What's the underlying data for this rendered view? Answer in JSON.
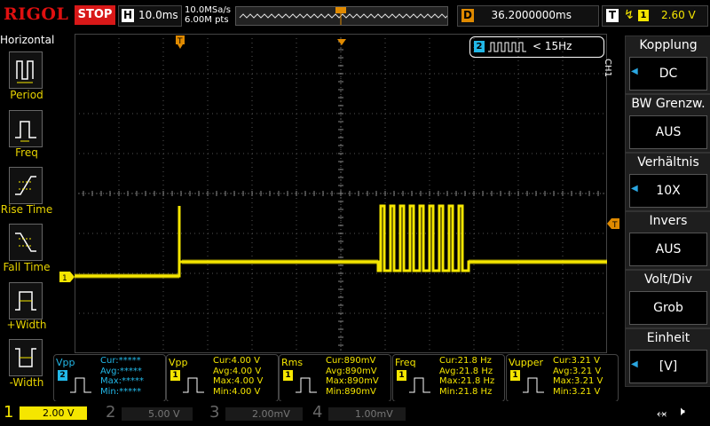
{
  "brand": "RIGOL",
  "run_state": "STOP",
  "horizontal": {
    "label": "H",
    "timebase": "10.0ms"
  },
  "sample": {
    "rate": "10.0MSa/s",
    "points": "6.00M pts"
  },
  "delay": {
    "label": "D",
    "value": "36.2000000ms"
  },
  "trigger": {
    "label": "T",
    "source": "1",
    "level": "2.60 V"
  },
  "left_menu": {
    "title": "Horizontal",
    "items": [
      {
        "label": "Period"
      },
      {
        "label": "Freq"
      },
      {
        "label": "Rise Time"
      },
      {
        "label": "Fall Time"
      },
      {
        "label": "+Width"
      },
      {
        "label": "-Width"
      }
    ]
  },
  "channel_tag": "CH1",
  "freq_counter": {
    "channel": "2",
    "value": "< 15Hz"
  },
  "right_menu": [
    {
      "title": "Kopplung",
      "value": "DC"
    },
    {
      "title": "BW Grenzw.",
      "value": "AUS"
    },
    {
      "title": "Verhältnis",
      "value": "10X"
    },
    {
      "title": "Invers",
      "value": "AUS"
    },
    {
      "title": "Volt/Div",
      "value": "Grob"
    },
    {
      "title": "Einheit",
      "value": "[V]"
    }
  ],
  "measurements": [
    {
      "name": "Vpp",
      "channel": "2",
      "color": "#22b8e8",
      "cur": "Cur:*****",
      "avg": "Avg:*****",
      "max": "Max:*****",
      "min": "Min:*****"
    },
    {
      "name": "Vpp",
      "channel": "1",
      "color": "#f5e600",
      "cur": "Cur:4.00 V",
      "avg": "Avg:4.00 V",
      "max": "Max:4.00 V",
      "min": "Min:4.00 V"
    },
    {
      "name": "Rms",
      "channel": "1",
      "color": "#f5e600",
      "cur": "Cur:890mV",
      "avg": "Avg:890mV",
      "max": "Max:890mV",
      "min": "Min:890mV"
    },
    {
      "name": "Freq",
      "channel": "1",
      "color": "#f5e600",
      "cur": "Cur:21.8 Hz",
      "avg": "Avg:21.8 Hz",
      "max": "Max:21.8 Hz",
      "min": "Min:21.8 Hz"
    },
    {
      "name": "Vupper",
      "channel": "1",
      "color": "#f5e600",
      "cur": "Cur:3.21 V",
      "avg": "Avg:3.21 V",
      "max": "Max:3.21 V",
      "min": "Min:3.21 V"
    }
  ],
  "channels": [
    {
      "num": "1",
      "scale": "2.00 V",
      "color": "#f5e600"
    },
    {
      "num": "2",
      "scale": "5.00 V",
      "color": "#22b8e8"
    },
    {
      "num": "3",
      "scale": "2.00mV",
      "color": "#d040d0"
    },
    {
      "num": "4",
      "scale": "1.00mV",
      "color": "#3a6ee8"
    }
  ],
  "colors": {
    "ch1": "#f5e600",
    "ch2": "#22b8e8",
    "ch3": "#d040d0",
    "ch4": "#3a6ee8",
    "trigger": "#e08a00",
    "stop": "#d81818"
  }
}
